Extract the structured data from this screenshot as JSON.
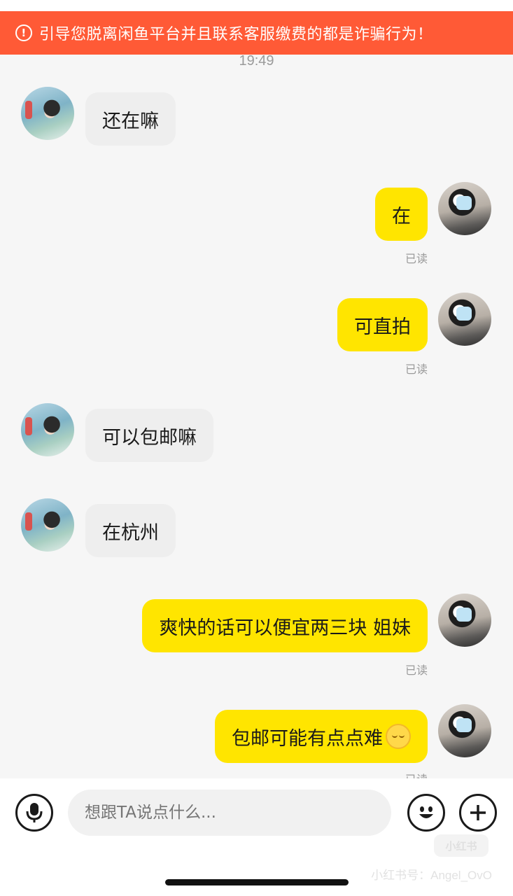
{
  "banner": {
    "icon": "exclamation-circle-icon",
    "text": "引导您脱离闲鱼平台并且联系客服缴费的都是诈骗行为！",
    "color": "#ff5a36"
  },
  "timestamp": "19:49",
  "messages": [
    {
      "sender": "peer",
      "text": "还在嘛"
    },
    {
      "sender": "self",
      "text": "在",
      "status": "已读"
    },
    {
      "sender": "self",
      "text": "可直拍",
      "status": "已读"
    },
    {
      "sender": "peer",
      "text": "可以包邮嘛"
    },
    {
      "sender": "peer",
      "text": "在杭州"
    },
    {
      "sender": "self",
      "text": "爽快的话可以便宜两三块 姐妹",
      "status": "已读"
    },
    {
      "sender": "self",
      "text": "包邮可能有点点难",
      "emoji": "relieved-face-emoji",
      "status": "已读"
    }
  ],
  "colors": {
    "self_bubble": "#ffe500",
    "peer_bubble": "#eeeeee",
    "background": "#f6f6f6"
  },
  "input_bar": {
    "voice_icon": "microphone-icon",
    "placeholder": "想跟TA说点什么...",
    "emoji_icon": "smiley-icon",
    "plus_icon": "plus-icon"
  },
  "watermark": {
    "logo_text": "小红书",
    "text": "小红书号：Angel_OvO"
  }
}
